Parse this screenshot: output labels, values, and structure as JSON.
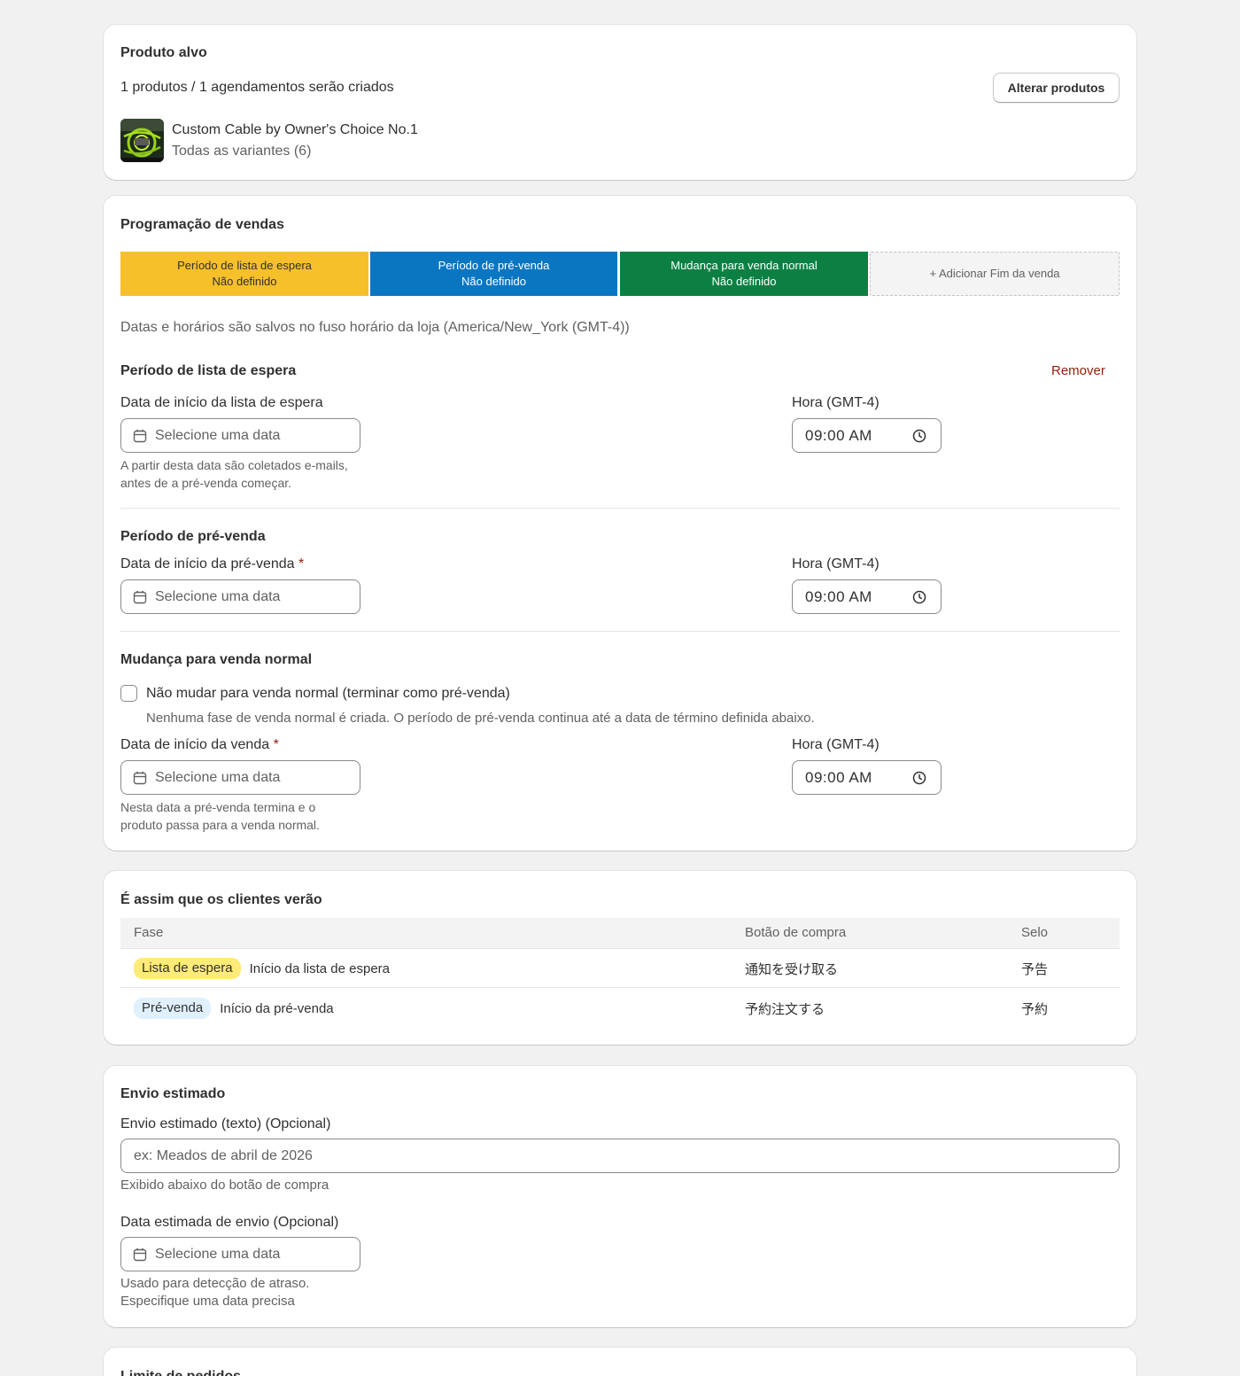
{
  "product_card": {
    "title": "Produto alvo",
    "summary": "1 produtos / 1 agendamentos serão criados",
    "change_button": "Alterar produtos",
    "product_name": "Custom Cable by Owner's Choice No.1",
    "variants": "Todas as variantes (6)"
  },
  "schedule_card": {
    "title": "Programação de vendas",
    "segments": [
      {
        "title": "Período de lista de espera",
        "status": "Não definido",
        "color": "#f6c02b",
        "text_color": "#303030"
      },
      {
        "title": "Período de pré-venda",
        "status": "Não definido",
        "color": "#0a76c1",
        "text_color": "#ffffff"
      },
      {
        "title": "Mudança para venda normal",
        "status": "Não definido",
        "color": "#0c8043",
        "text_color": "#ffffff"
      }
    ],
    "add_segment": "+ Adicionar Fim da venda",
    "timezone_note": "Datas e horários são salvos no fuso horário da loja (America/New_York (GMT-4))",
    "waitlist": {
      "heading": "Período de lista de espera",
      "remove": "Remover",
      "date_label": "Data de início da lista de espera",
      "date_placeholder": "Selecione uma data",
      "date_help": "A partir desta data são coletados e-mails, antes de a pré-venda começar.",
      "time_label": "Hora (GMT-4)",
      "time_value": "09:00  AM"
    },
    "presale": {
      "heading": "Período de pré-venda",
      "date_label": "Data de início da pré-venda",
      "required": "*",
      "date_placeholder": "Selecione uma data",
      "time_label": "Hora (GMT-4)",
      "time_value": "09:00  AM"
    },
    "normal": {
      "heading": "Mudança para venda normal",
      "checkbox_label": "Não mudar para venda normal (terminar como pré-venda)",
      "checkbox_help": "Nenhuma fase de venda normal é criada. O período de pré-venda continua até a data de término definida abaixo.",
      "checked": false,
      "date_label": "Data de início da venda",
      "required": "*",
      "date_placeholder": "Selecione uma data",
      "date_help": "Nesta data a pré-venda termina e o produto passa para a venda normal.",
      "time_label": "Hora (GMT-4)",
      "time_value": "09:00  AM"
    }
  },
  "preview_card": {
    "title": "É assim que os clientes verão",
    "columns": [
      "Fase",
      "Botão de compra",
      "Selo"
    ],
    "rows": [
      {
        "badge": "Lista de espera",
        "badge_color": "#ffeb78",
        "phase": "Início da lista de espera",
        "button": "通知を受け取る",
        "seal": "予告"
      },
      {
        "badge": "Pré-venda",
        "badge_color": "#e0f0ff",
        "phase": "Início da pré-venda",
        "button": "予約注文する",
        "seal": "予約"
      }
    ]
  },
  "shipping_card": {
    "title": "Envio estimado",
    "text_label": "Envio estimado (texto) (Opcional)",
    "text_placeholder": "ex: Meados de abril de 2026",
    "text_help": "Exibido abaixo do botão de compra",
    "date_label": "Data estimada de envio (Opcional)",
    "date_placeholder": "Selecione uma data",
    "date_help_1": "Usado para detecção de atraso.",
    "date_help_2": "Especifique uma data precisa"
  },
  "limit_card": {
    "title": "Limite de pedidos"
  }
}
